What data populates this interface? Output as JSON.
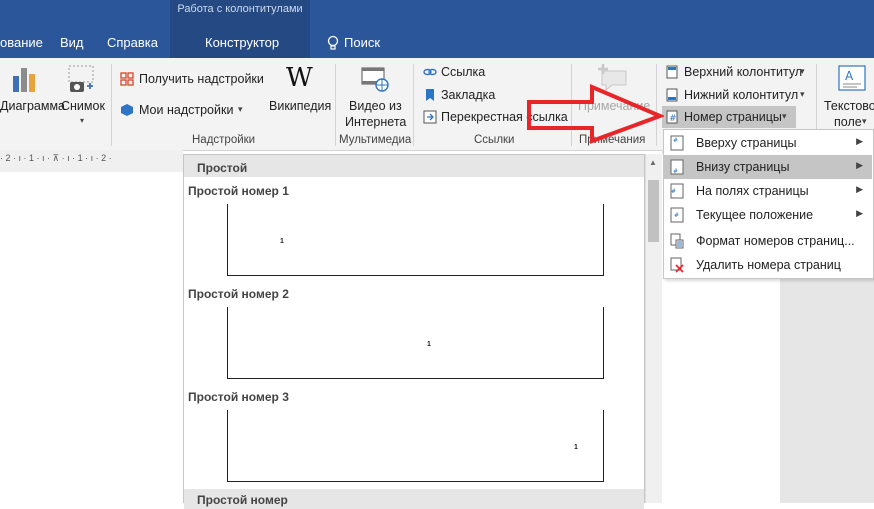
{
  "contextual_group": "Работа с колонтитулами",
  "tabs": [
    "ование",
    "Вид",
    "Справка",
    "Конструктор",
    "Поиск"
  ],
  "ribbon": {
    "chart_label": "Диаграмма",
    "screenshot_label": "Снимок",
    "get_addins": "Получить надстройки",
    "my_addins": "Мои надстройки",
    "wikipedia": "Википедия",
    "online_video_line1": "Видео из",
    "online_video_line2": "Интернета",
    "link": "Ссылка",
    "bookmark": "Закладка",
    "cross_ref": "Перекрестная ссылка",
    "comment": "Примечание",
    "header": "Верхний колонтитул",
    "footer": "Нижний колонтитул",
    "page_number": "Номер страницы",
    "textbox_line1": "Текстово",
    "textbox_line2": "поле",
    "groups": {
      "addins": "Надстройки",
      "media": "Мультимедиа",
      "links": "Ссылки",
      "comments": "Примечания"
    }
  },
  "ruler_text": "· 2 · ı · 1 · ı · ⊼ · ı · 1 · ı · 2 ·",
  "gallery": {
    "section_title": "Простой",
    "items": [
      {
        "title": "Простой номер 1",
        "num": "1"
      },
      {
        "title": "Простой номер 2",
        "num": "1"
      },
      {
        "title": "Простой номер 3",
        "num": "1"
      }
    ],
    "next_section": "Простой номер"
  },
  "menu": {
    "items": [
      {
        "label": "Вверху страницы",
        "submenu": true
      },
      {
        "label": "Внизу страницы",
        "submenu": true,
        "highlighted": true
      },
      {
        "label": "На полях страницы",
        "submenu": true
      },
      {
        "label": "Текущее положение",
        "submenu": true
      },
      {
        "label": "Формат номеров страниц...",
        "submenu": false
      },
      {
        "label": "Удалить номера страниц",
        "submenu": false
      }
    ]
  },
  "colors": {
    "title_bar": "#2b579a",
    "arrow": "#e8262a",
    "menu_highlight": "#c5c5c5"
  }
}
